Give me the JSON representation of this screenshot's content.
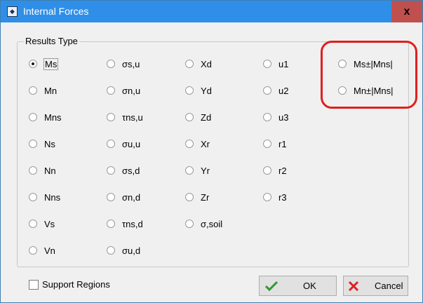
{
  "window": {
    "title": "Internal Forces",
    "close_label": "x"
  },
  "group": {
    "title": "Results Type"
  },
  "radios": [
    {
      "label": "Ms",
      "checked": true
    },
    {
      "label": "Mn"
    },
    {
      "label": "Mns"
    },
    {
      "label": "Ns"
    },
    {
      "label": "Nn"
    },
    {
      "label": "Nns"
    },
    {
      "label": "Vs"
    },
    {
      "label": "Vn"
    },
    {
      "label": "σs,u"
    },
    {
      "label": "σn,u"
    },
    {
      "label": "τns,u"
    },
    {
      "label": "σu,u"
    },
    {
      "label": "σs,d"
    },
    {
      "label": "σn,d"
    },
    {
      "label": "τns,d"
    },
    {
      "label": "σu,d"
    },
    {
      "label": "Xd"
    },
    {
      "label": "Yd"
    },
    {
      "label": "Zd"
    },
    {
      "label": "Xr"
    },
    {
      "label": "Yr"
    },
    {
      "label": "Zr"
    },
    {
      "label": "σ,soil"
    },
    {
      "label": "u1"
    },
    {
      "label": "u2"
    },
    {
      "label": "u3"
    },
    {
      "label": "r1"
    },
    {
      "label": "r2"
    },
    {
      "label": "r3"
    },
    {
      "label": "Ms±|Mns|"
    },
    {
      "label": "Mn±|Mns|"
    }
  ],
  "support_regions": {
    "label": "Support Regions",
    "checked": false
  },
  "buttons": {
    "ok": "OK",
    "cancel": "Cancel"
  },
  "colors": {
    "title_bar": "#2f8fe8",
    "highlight": "#e01f1f",
    "close": "#c0504d"
  },
  "icons": {
    "ok": "green-check-icon",
    "cancel": "red-x-icon",
    "app": "app-icon"
  }
}
